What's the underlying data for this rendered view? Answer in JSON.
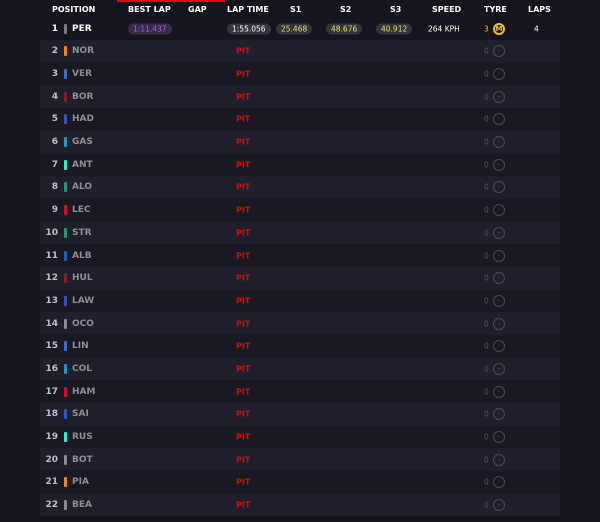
{
  "header": {
    "position": "POSITION",
    "best_lap": "BEST LAP",
    "gap": "GAP",
    "lap_time": "LAP TIME",
    "s1": "S1",
    "s2": "S2",
    "s3": "S3",
    "speed": "SPEED",
    "tyre": "TYRE",
    "laps": "LAPS"
  },
  "colors": {
    "accent": "#e10600",
    "best_lap": "#b25be0",
    "sector_yellow": "#e8e05a",
    "medium_tyre": "#f0c020",
    "pit": "#e10600"
  },
  "leader": {
    "pos": "1",
    "driver": "PER",
    "team_color": "#7a7a85",
    "best_lap": "1:11.437",
    "lap_time": "1:55.056",
    "s1": "25.468",
    "s2": "48.676",
    "s3": "40.912",
    "speed": "264 KPH",
    "tyre_age": "3",
    "tyre": "M",
    "tyre_icon": "medium-tyre-icon",
    "laps": "4"
  },
  "rows": [
    {
      "pos": "2",
      "driver": "NOR",
      "team_color": "#ff8000",
      "status": "PIT",
      "tyre_age": "0",
      "tyre": "-"
    },
    {
      "pos": "3",
      "driver": "VER",
      "team_color": "#3671c6",
      "status": "PIT",
      "tyre_age": "0",
      "tyre": "-"
    },
    {
      "pos": "4",
      "driver": "BOR",
      "team_color": "#8a1e1e",
      "status": "PIT",
      "tyre_age": "0",
      "tyre": "-"
    },
    {
      "pos": "5",
      "driver": "HAD",
      "team_color": "#3a4fb8",
      "status": "PIT",
      "tyre_age": "0",
      "tyre": "-"
    },
    {
      "pos": "6",
      "driver": "GAS",
      "team_color": "#2293d1",
      "status": "PIT",
      "tyre_age": "0",
      "tyre": "-"
    },
    {
      "pos": "7",
      "driver": "ANT",
      "team_color": "#27f4d2",
      "status": "PIT",
      "tyre_age": "0",
      "tyre": "-"
    },
    {
      "pos": "8",
      "driver": "ALO",
      "team_color": "#229971",
      "status": "PIT",
      "tyre_age": "0",
      "tyre": "-"
    },
    {
      "pos": "9",
      "driver": "LEC",
      "team_color": "#e8002d",
      "status": "PIT",
      "tyre_age": "0",
      "tyre": "-"
    },
    {
      "pos": "10",
      "driver": "STR",
      "team_color": "#229971",
      "status": "PIT",
      "tyre_age": "0",
      "tyre": "-"
    },
    {
      "pos": "11",
      "driver": "ALB",
      "team_color": "#1e5bc6",
      "status": "PIT",
      "tyre_age": "0",
      "tyre": "-"
    },
    {
      "pos": "12",
      "driver": "HUL",
      "team_color": "#8a1e1e",
      "status": "PIT",
      "tyre_age": "0",
      "tyre": "-"
    },
    {
      "pos": "13",
      "driver": "LAW",
      "team_color": "#3a4fb8",
      "status": "PIT",
      "tyre_age": "0",
      "tyre": "-"
    },
    {
      "pos": "14",
      "driver": "OCO",
      "team_color": "#8a8a94",
      "status": "PIT",
      "tyre_age": "0",
      "tyre": "-"
    },
    {
      "pos": "15",
      "driver": "LIN",
      "team_color": "#3671c6",
      "status": "PIT",
      "tyre_age": "0",
      "tyre": "-"
    },
    {
      "pos": "16",
      "driver": "COL",
      "team_color": "#2293d1",
      "status": "PIT",
      "tyre_age": "0",
      "tyre": "-"
    },
    {
      "pos": "17",
      "driver": "HAM",
      "team_color": "#e8002d",
      "status": "PIT",
      "tyre_age": "0",
      "tyre": "-"
    },
    {
      "pos": "18",
      "driver": "SAI",
      "team_color": "#1e5bc6",
      "status": "PIT",
      "tyre_age": "0",
      "tyre": "-"
    },
    {
      "pos": "19",
      "driver": "RUS",
      "team_color": "#27f4d2",
      "status": "PIT",
      "tyre_age": "0",
      "tyre": "-"
    },
    {
      "pos": "20",
      "driver": "BOT",
      "team_color": "#8a8a94",
      "status": "PIT",
      "tyre_age": "0",
      "tyre": "-"
    },
    {
      "pos": "21",
      "driver": "PIA",
      "team_color": "#ff8000",
      "status": "PIT",
      "tyre_age": "0",
      "tyre": "-"
    },
    {
      "pos": "22",
      "driver": "BEA",
      "team_color": "#8a8a94",
      "status": "PIT",
      "tyre_age": "0",
      "tyre": "-"
    }
  ]
}
